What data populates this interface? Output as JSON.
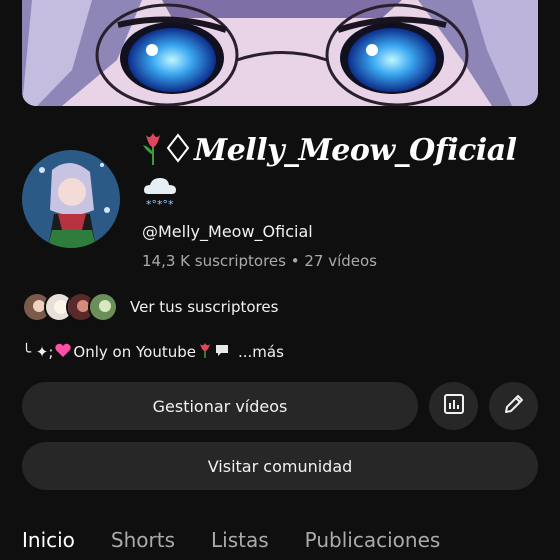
{
  "channel": {
    "name": "Melly_Meow_Oficial",
    "handle": "@Melly_Meow_Oficial",
    "stats": "14,3 K suscriptores • 27 vídeos",
    "subscribers_link": "Ver tus suscriptores",
    "description_text": "Only on Youtube",
    "description_prefix": "╰ ✦;",
    "more_label": "...más"
  },
  "buttons": {
    "manage_videos": "Gestionar vídeos",
    "visit_community": "Visitar comunidad"
  },
  "tabs": [
    "Inicio",
    "Shorts",
    "Listas",
    "Publicaciones"
  ],
  "icons": {
    "analytics": "bar-chart-icon",
    "edit": "pencil-icon"
  },
  "colors": {
    "background": "#0f0f0f",
    "button": "#272727",
    "secondary_text": "#aaaaaa"
  }
}
